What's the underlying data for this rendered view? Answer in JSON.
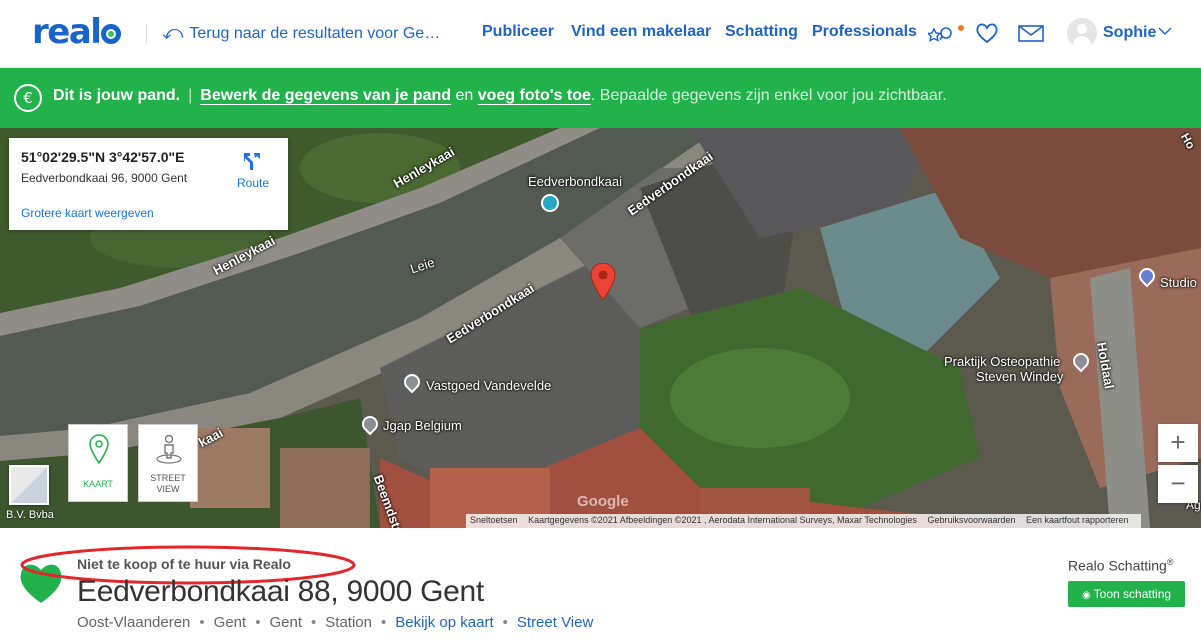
{
  "header": {
    "logo": "realo",
    "back_link": "Terug naar de resultaten voor Ge…",
    "nav": [
      "Publiceer",
      "Vind een makelaar",
      "Schatting",
      "Professionals"
    ],
    "icons": [
      "saved-search-icon",
      "heart-icon",
      "mail-icon"
    ],
    "user_name": "Sophie"
  },
  "banner": {
    "lead": "Dit is jouw pand.",
    "link_edit": "Bewerk de gegevens van je pand",
    "conj": "en",
    "link_photos": "voeg foto's toe",
    "note": ". Bepaalde gegevens zijn enkel voor jou zichtbaar.",
    "color": "#21b24b"
  },
  "map": {
    "info_card": {
      "coords": "51°02'29.5\"N 3°42'57.0\"E",
      "address": "Eedverbondkaai 96, 9000 Gent",
      "bigger_map": "Grotere kaart weergeven",
      "route": "Route"
    },
    "labels": {
      "henleykaai_1": "Henleykaai",
      "henleykaai_2": "Henleykaai",
      "leie": "Leie",
      "eedverbondkaai_poi": "Eedverbondkaai",
      "eedverbondkaai_1": "Eedverbondkaai",
      "eedverbondkaai_2": "Eedverbondkaai",
      "vastgoed": "Vastgoed Vandevelde",
      "jgap": "Jgap Belgium",
      "praktijk_1": "Praktijk Osteopathie",
      "praktijk_2": "Steven Windey",
      "holdaal": "Holdaal",
      "studio": "Studio",
      "beemdstr": "Beemdstr",
      "kaai": "kaai",
      "bv": "B.V. Bvba",
      "google": "Google",
      "edge_top": "Ho",
      "edge_ag": "Ag"
    },
    "view_buttons": {
      "map": "KAART",
      "street_1": "STREET",
      "street_2": "VIEW"
    },
    "zoom": {
      "in": "+",
      "out": "−"
    },
    "attribution": [
      "Sneltoetsen",
      "Kaartgegevens ©2021 Afbeeldingen ©2021 , Aerodata International Surveys, Maxar Technologies",
      "Gebruiksvoorwaarden",
      "Een kaartfout rapporteren"
    ]
  },
  "property": {
    "status": "Niet te koop of te huur via Realo",
    "address": "Eedverbondkaai 88, 9000 Gent",
    "crumbs": [
      "Oost-Vlaanderen",
      "Gent",
      "Gent",
      "Station"
    ],
    "map_link": "Bekijk op kaart",
    "streetview_link": "Street View",
    "estimate_title": "Realo Schatting",
    "estimate_sup": "®",
    "estimate_button": "Toon schatting",
    "accent_color": "#21b24b",
    "annotation_color": "#e3262b"
  }
}
